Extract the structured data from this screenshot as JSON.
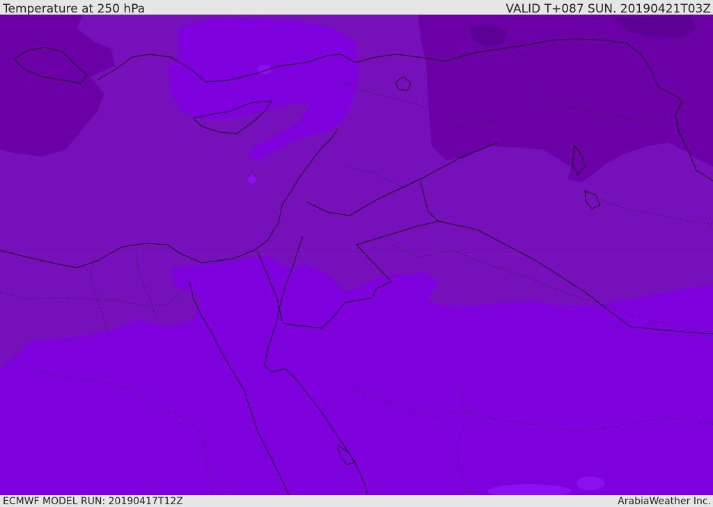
{
  "header": {
    "title": "Temperature at 250 hPa",
    "valid": "VALID T+087 SUN. 20190421T03Z"
  },
  "footer": {
    "model_run": "ECMWF MODEL RUN: 20190417T12Z",
    "credit": "ArabiaWeather Inc."
  },
  "colors": {
    "cold_band": "#6a00a6",
    "mid_band": "#7610bb",
    "warm_band": "#7e00dd",
    "warmest_band": "#8a10f2",
    "border_line": "#111111",
    "background_bar": "#e6e6e6"
  }
}
